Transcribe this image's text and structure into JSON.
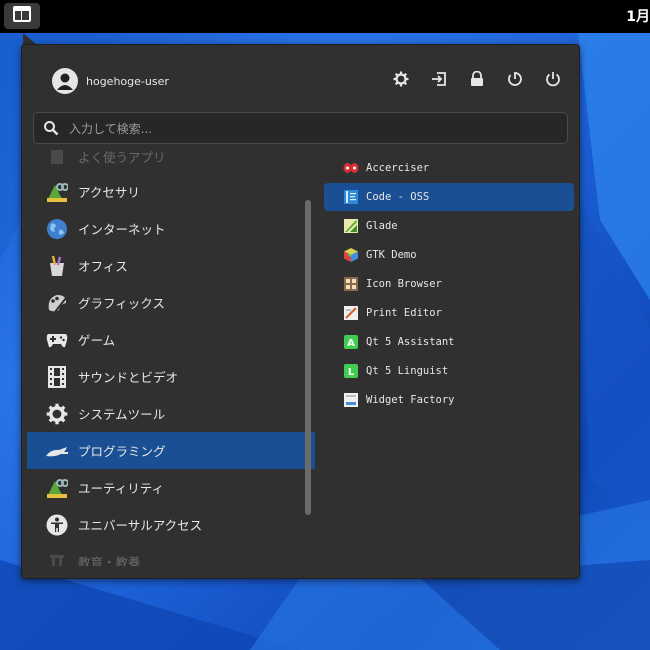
{
  "topbar": {
    "clock_partial": "1月"
  },
  "user": {
    "name": "hogehoge-user"
  },
  "actions": [
    {
      "icon": "settings-icon"
    },
    {
      "icon": "logout-icon"
    },
    {
      "icon": "lock-icon"
    },
    {
      "icon": "restart-icon"
    },
    {
      "icon": "power-icon"
    }
  ],
  "search": {
    "placeholder": "入力して検索..."
  },
  "categories": [
    {
      "label": "よく使うアプリ",
      "icon": "favorites-icon",
      "faded": true
    },
    {
      "label": "アクセサリ",
      "icon": "accessories-icon"
    },
    {
      "label": "インターネット",
      "icon": "internet-icon"
    },
    {
      "label": "オフィス",
      "icon": "office-icon"
    },
    {
      "label": "グラフィックス",
      "icon": "graphics-icon"
    },
    {
      "label": "ゲーム",
      "icon": "games-icon"
    },
    {
      "label": "サウンドとビデオ",
      "icon": "multimedia-icon"
    },
    {
      "label": "システムツール",
      "icon": "system-tools-icon"
    },
    {
      "label": "プログラミング",
      "icon": "programming-icon",
      "selected": true
    },
    {
      "label": "ユーティリティ",
      "icon": "utilities-icon"
    },
    {
      "label": "ユニバーサルアクセス",
      "icon": "accessibility-icon"
    },
    {
      "label": "教育・教養",
      "icon": "education-icon",
      "faded": true
    }
  ],
  "apps": [
    {
      "label": "Accerciser",
      "icon": "accerciser-icon",
      "color": "#d33"
    },
    {
      "label": "Code - OSS",
      "icon": "code-oss-icon",
      "color": "#2f8bd8",
      "selected": true
    },
    {
      "label": "Glade",
      "icon": "glade-icon",
      "color": "#6bbf3a"
    },
    {
      "label": "GTK Demo",
      "icon": "gtk-demo-icon",
      "color": "#e0a030"
    },
    {
      "label": "Icon Browser",
      "icon": "icon-browser-icon",
      "color": "#8a6a4a"
    },
    {
      "label": "Print Editor",
      "icon": "print-editor-icon",
      "color": "#ddd"
    },
    {
      "label": "Qt 5 Assistant",
      "icon": "qt-assistant-icon",
      "color": "#41cd52"
    },
    {
      "label": "Qt 5 Linguist",
      "icon": "qt-linguist-icon",
      "color": "#41cd52"
    },
    {
      "label": "Widget Factory",
      "icon": "widget-factory-icon",
      "color": "#4a8ad8"
    }
  ]
}
